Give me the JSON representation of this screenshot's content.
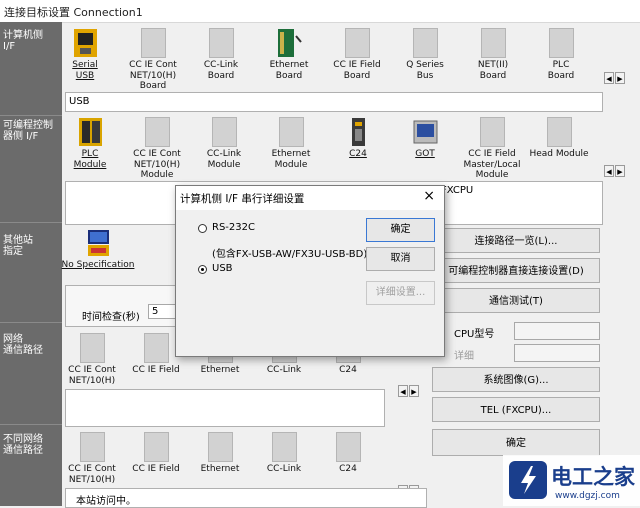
{
  "window": {
    "title": "连接目标设置 Connection1"
  },
  "left_labels": [
    "计算机侧\nI/F",
    "可编程控制\n器侧 I/F",
    "其他站\n指定",
    "网络\n通信路径",
    "不同网络\n通信路径"
  ],
  "pc_if": {
    "items": [
      {
        "label": "Serial\nUSB",
        "icon": "serial-usb-icon",
        "link": true
      },
      {
        "label": "CC IE Cont\nNET/10(H)\nBoard",
        "icon": "board-icon",
        "link": false
      },
      {
        "label": "CC-Link\nBoard",
        "icon": "board-icon",
        "link": false
      },
      {
        "label": "Ethernet\nBoard",
        "icon": "ethernet-board-icon",
        "link": false
      },
      {
        "label": "CC IE Field\nBoard",
        "icon": "board-icon",
        "link": false
      },
      {
        "label": "Q Series\nBus",
        "icon": "board-icon",
        "link": false
      },
      {
        "label": "NET(II)\nBoard",
        "icon": "board-icon",
        "link": false
      },
      {
        "label": "PLC\nBoard",
        "icon": "board-icon",
        "link": false
      }
    ],
    "selection_text": "USB"
  },
  "plc_if": {
    "items": [
      {
        "label": "PLC\nModule",
        "icon": "plc-module-icon",
        "link": true
      },
      {
        "label": "CC IE Cont\nNET/10(H)\nModule",
        "icon": "module-icon",
        "link": false
      },
      {
        "label": "CC-Link\nModule",
        "icon": "module-icon",
        "link": false
      },
      {
        "label": "Ethernet\nModule",
        "icon": "module-icon",
        "link": false
      },
      {
        "label": "C24",
        "icon": "c24-icon",
        "link": true
      },
      {
        "label": "GOT",
        "icon": "got-icon",
        "link": true
      },
      {
        "label": "CC IE Field\nMaster/Local\nModule",
        "icon": "module-icon",
        "link": false
      },
      {
        "label": "Head Module",
        "icon": "module-icon",
        "link": false
      }
    ],
    "detail_text": "FXCPU"
  },
  "other_station": {
    "item": {
      "label": "No Specification",
      "icon": "no-spec-icon"
    },
    "time_check_label": "时间检查(秒)",
    "time_check_value": "5"
  },
  "network_route": {
    "items": [
      "CC IE Cont\nNET/10(H)",
      "CC IE Field",
      "Ethernet",
      "CC-Link",
      "C24"
    ]
  },
  "different_network": {
    "items": [
      "CC IE Cont\nNET/10(H)",
      "CC IE Field",
      "Ethernet",
      "CC-Link",
      "C24"
    ]
  },
  "status_text": "本站访问中。",
  "right_buttons": {
    "route_list": "连接路径一览(L)...",
    "direct_connect": "可编程控制器直接连接设置(D)",
    "comm_test": "通信测试(T)",
    "cpu_type_label": "CPU型号",
    "detail_label": "详细",
    "system_image": "系统图像(G)...",
    "tel": "TEL (FXCPU)...",
    "ok": "确定"
  },
  "dialog": {
    "title": "计算机侧 I/F 串行详细设置",
    "close": "×",
    "rs232c": "RS-232C",
    "rs232c_note": "(包含FX-USB-AW/FX3U-USB-BD)",
    "usb": "USB",
    "ok": "确定",
    "cancel": "取消",
    "detail": "详细设置..."
  },
  "watermark": {
    "text": "电工之家",
    "url": "www.dgzj.com"
  },
  "colors": {
    "leftbar": "#6b6b6b",
    "watermark_blue": "#1a3e8c"
  }
}
